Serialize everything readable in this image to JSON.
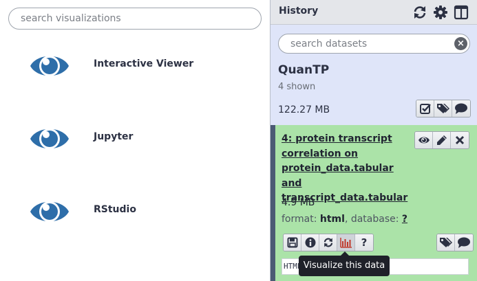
{
  "visualizations": {
    "search_placeholder": "search visualizations",
    "items": [
      {
        "label": "Interactive Viewer",
        "icon": "eye-icon"
      },
      {
        "label": "Jupyter",
        "icon": "eye-icon"
      },
      {
        "label": "RStudio",
        "icon": "eye-icon"
      }
    ],
    "icon_color": "#2e6ea9"
  },
  "history": {
    "title": "History",
    "header_icons": [
      "refresh-icon",
      "gear-icon",
      "columns-icon"
    ],
    "search_placeholder": "search datasets",
    "name": "QuanTP",
    "shown": "4 shown",
    "size": "122.27 MB",
    "actions": [
      "check-square-icon",
      "tags-icon",
      "comment-icon"
    ],
    "dataset": {
      "title": "4: protein transcript correlation on protein_data.tabular and transcript_data.tabular",
      "title_icons": [
        "eye-icon",
        "pencil-icon",
        "close-icon"
      ],
      "size": "4.9 MB",
      "format_label": "format:",
      "format": "html",
      "database_label": ", database:",
      "database": "?",
      "actions": [
        "save-icon",
        "info-icon",
        "rerun-icon",
        "visualize-icon",
        "help-icon"
      ],
      "tag_actions": [
        "tags-icon",
        "comment-icon"
      ],
      "preview": "HTML"
    },
    "tooltip": "Visualize this data",
    "colors": {
      "panel": "#dfe5f9",
      "dataset_ok": "#abe3a8",
      "dataset_border": "#4b5a74"
    }
  }
}
